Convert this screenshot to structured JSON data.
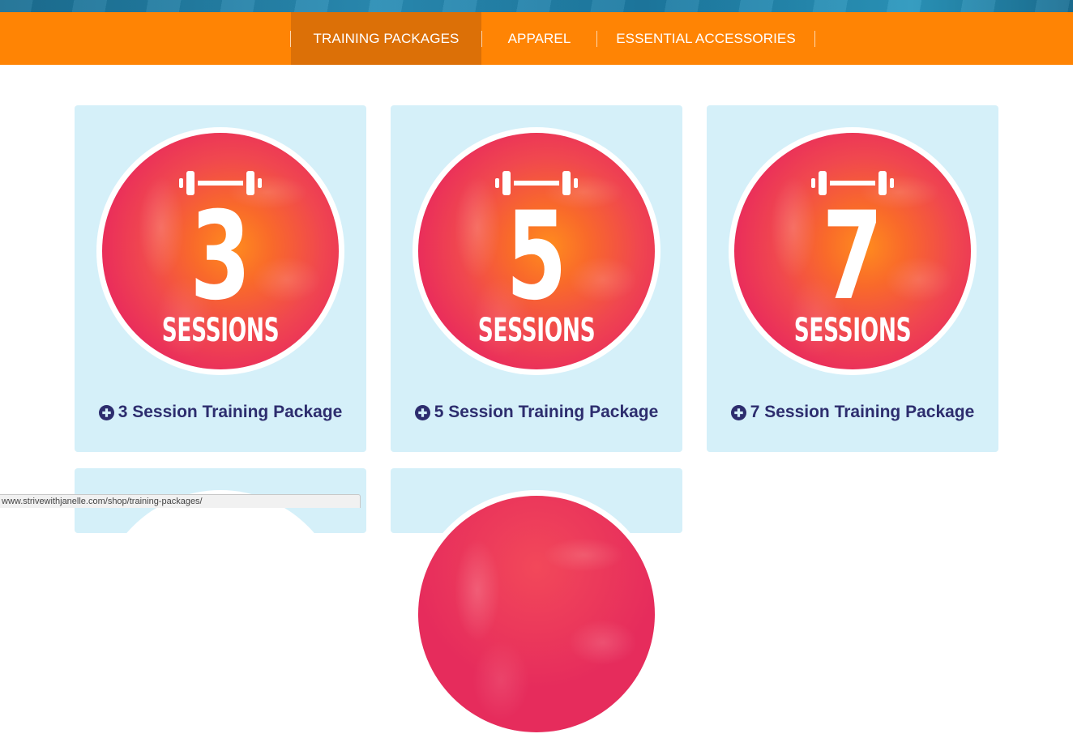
{
  "nav": {
    "items": [
      {
        "label": "TRAINING PACKAGES",
        "active": true
      },
      {
        "label": "APPAREL",
        "active": false
      },
      {
        "label": "ESSENTIAL ACCESSORIES",
        "active": false
      }
    ],
    "colors": {
      "bar": "#ff8404",
      "active": "#dc7007"
    }
  },
  "products": [
    {
      "badge_number": "3",
      "badge_word": "SESSIONS",
      "title": "3 Session Training Package",
      "icon": "plus-circle-icon"
    },
    {
      "badge_number": "5",
      "badge_word": "SESSIONS",
      "title": "5 Session Training Package",
      "icon": "plus-circle-icon"
    },
    {
      "badge_number": "7",
      "badge_word": "SESSIONS",
      "title": "7 Session Training Package",
      "icon": "plus-circle-icon"
    }
  ],
  "status_bar": {
    "url": "www.strivewithjanelle.com/shop/training-packages/"
  },
  "colors": {
    "card_bg": "#d5f0f9",
    "title_text": "#2d2d6e"
  }
}
